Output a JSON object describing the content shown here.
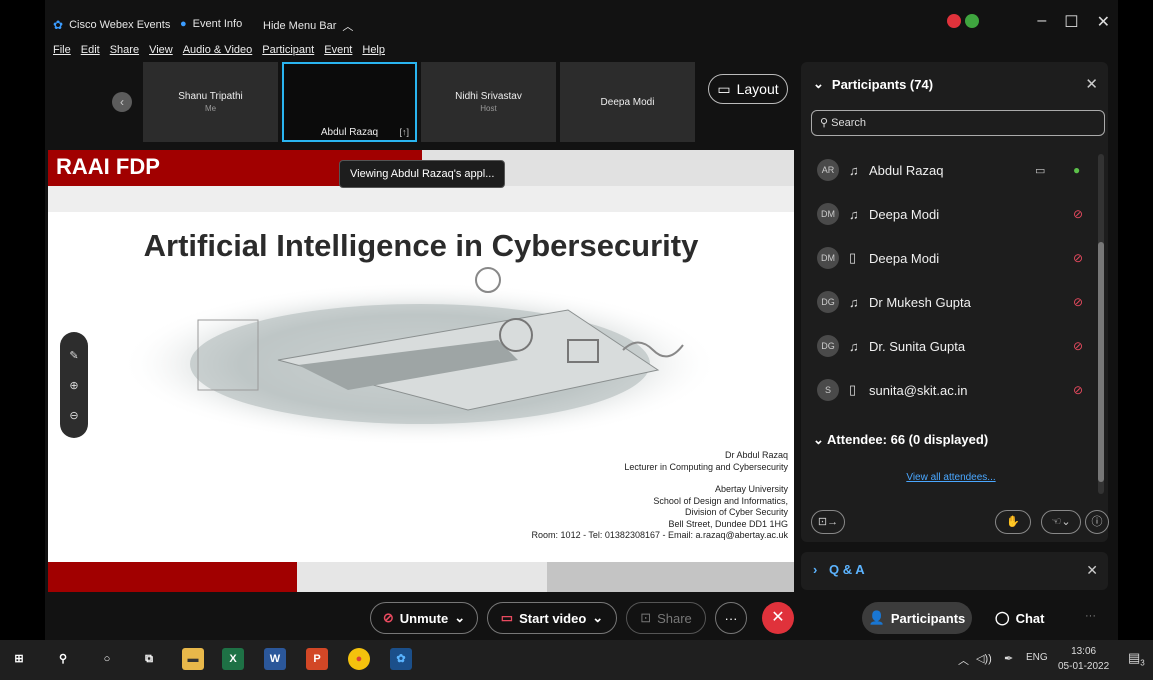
{
  "titlebar": {
    "app_name": "Cisco Webex Events",
    "event_info": "Event Info",
    "hide_menu": "Hide Menu Bar",
    "chevron": "︿"
  },
  "menu": [
    "File",
    "Edit",
    "Share",
    "View",
    "Audio & Video",
    "Participant",
    "Event",
    "Help"
  ],
  "window_controls": {
    "minimize": "–",
    "maximize": "☐",
    "close": "✕"
  },
  "thumbnails": [
    {
      "name": "Shanu Tripathi",
      "sub": "Me"
    },
    {
      "name": "Abdul Razaq",
      "sub": ""
    },
    {
      "name": "Nidhi Srivastav",
      "sub": "Host"
    },
    {
      "name": "Deepa Modi",
      "sub": ""
    }
  ],
  "layout_button": "Layout",
  "tooltip": "Viewing Abdul Razaq's appl...",
  "slide": {
    "brand": "RAAI FDP",
    "title": "Artificial Intelligence in Cybersecurity",
    "credits": [
      "Dr Abdul Razaq",
      "Lecturer in Computing and Cybersecurity",
      "",
      "Abertay University",
      "School of Design and Informatics,",
      "Division of Cyber Security",
      "Bell Street, Dundee DD1 1HG",
      "Room: 1012 - Tel: 01382308167 - Email: a.razaq@abertay.ac.uk"
    ]
  },
  "panel": {
    "title": "Participants (74)",
    "search_placeholder": "Search",
    "participants": [
      {
        "initials": "AR",
        "name": "Abdul Razaq",
        "device": "headset",
        "camera": true,
        "mic": "on"
      },
      {
        "initials": "DM",
        "name": "Deepa Modi",
        "device": "headset",
        "camera": false,
        "mic": "off"
      },
      {
        "initials": "DM",
        "name": "Deepa Modi",
        "device": "mobile",
        "camera": false,
        "mic": "off"
      },
      {
        "initials": "DG",
        "name": "Dr Mukesh Gupta",
        "device": "headset",
        "camera": false,
        "mic": "off"
      },
      {
        "initials": "DG",
        "name": "Dr. Sunita Gupta",
        "device": "headset",
        "camera": false,
        "mic": "off"
      },
      {
        "initials": "S",
        "name": "sunita@skit.ac.in",
        "device": "mobile",
        "camera": false,
        "mic": "off"
      }
    ],
    "attendee_header": "Attendee: 66 (0 displayed)",
    "view_all": "View all attendees..."
  },
  "qa": {
    "label": "Q & A"
  },
  "controls": {
    "unmute": "Unmute",
    "start_video": "Start video",
    "share": "Share",
    "more": "···",
    "participants": "Participants",
    "chat": "Chat"
  },
  "taskbar": {
    "lang": "ENG",
    "time": "13:06",
    "date": "05-01-2022",
    "notifications": "3"
  },
  "colors": {
    "accent_blue": "#2ab5f0",
    "slide_red": "#a10000",
    "end_red": "#e0323b",
    "mic_on": "#5cc14a",
    "mic_off": "#e84a5f"
  }
}
